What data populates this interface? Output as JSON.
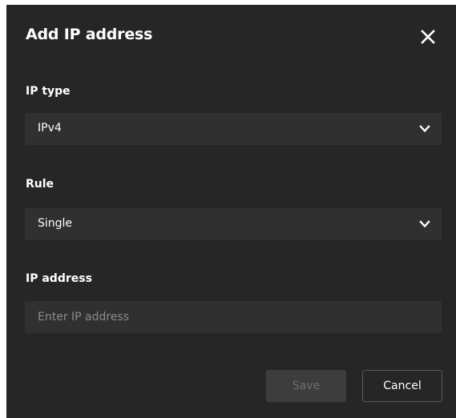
{
  "dialog": {
    "title": "Add IP address",
    "close_icon": "close-icon"
  },
  "fields": {
    "ip_type": {
      "label": "IP type",
      "value": "IPv4",
      "icon": "chevron-down-icon"
    },
    "rule": {
      "label": "Rule",
      "value": "Single",
      "icon": "chevron-down-icon"
    },
    "ip_address": {
      "label": "IP address",
      "value": "",
      "placeholder": "Enter IP address"
    }
  },
  "buttons": {
    "save_label": "Save",
    "save_disabled": true,
    "cancel_label": "Cancel"
  },
  "colors": {
    "dialog_background": "#262626",
    "field_background": "#303030",
    "text_primary": "#ffffff",
    "placeholder": "#8a8a8a",
    "disabled_button": "#3d3d3d"
  }
}
